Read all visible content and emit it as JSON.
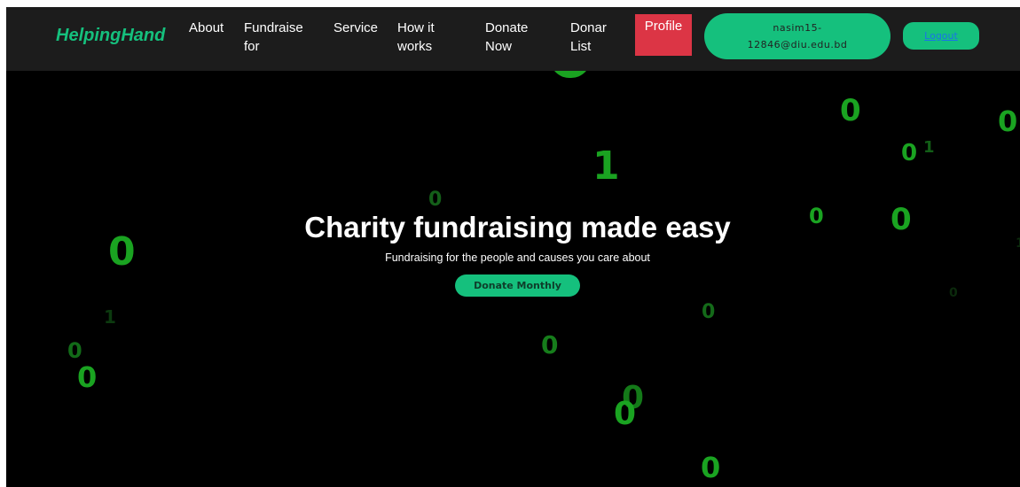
{
  "navbar": {
    "brand": "HelpingHand",
    "links": {
      "about": "About",
      "fundraise": "Fundraise\nfor",
      "service": "Service",
      "how": "How it\nworks",
      "donate": "Donate\nNow",
      "donar": "Donar\nList"
    },
    "profile_label": "Profile",
    "user_email": "nasim15-\n12846@diu.edu.bd",
    "logout_label": "Logout"
  },
  "hero": {
    "title": "Charity fundraising made easy",
    "subtitle": "Fundraising for the people and causes you care about",
    "cta_label": "Donate Monthly"
  },
  "background_digits": [
    "0",
    "0",
    "0",
    "1",
    "1",
    "0",
    "0",
    "0",
    "0",
    "0",
    "1",
    "0",
    "0",
    "0",
    "0",
    "0",
    "0",
    "0",
    "1"
  ],
  "colors": {
    "brand": "#15c07d",
    "navbar_bg": "#1c1c1c",
    "page_bg": "#000000",
    "profile": "#dc3545",
    "digit": "#1aa321"
  }
}
